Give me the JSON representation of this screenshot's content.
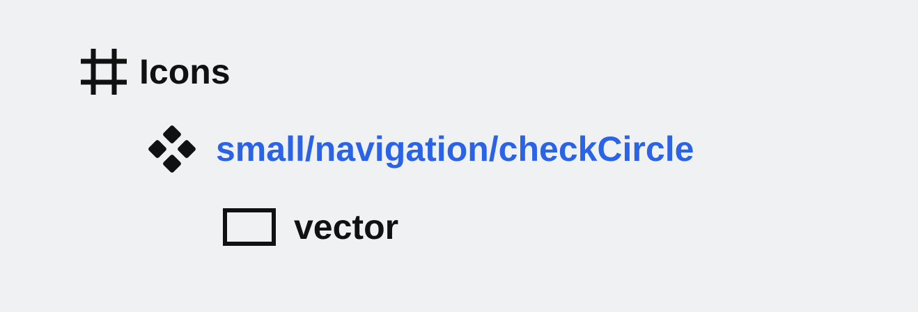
{
  "layers": {
    "frame": {
      "name": "Icons",
      "icon": "frame-hash-icon"
    },
    "component": {
      "name": "small/navigation/checkCircle",
      "icon": "component-diamonds-icon",
      "color": "#2b63e6"
    },
    "vector": {
      "name": "vector",
      "icon": "vector-rectangle-icon"
    }
  }
}
